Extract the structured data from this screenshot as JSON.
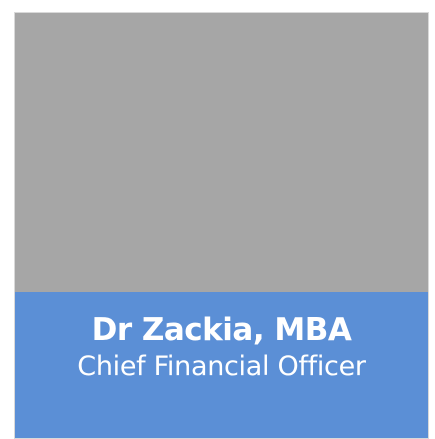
{
  "profile": {
    "name": "Dr Zackia, MBA",
    "title": "Chief Financial Officer"
  },
  "colors": {
    "photo_placeholder": "#a6a6a6",
    "caption_background": "#5b8fd6",
    "caption_text": "#ffffff"
  }
}
